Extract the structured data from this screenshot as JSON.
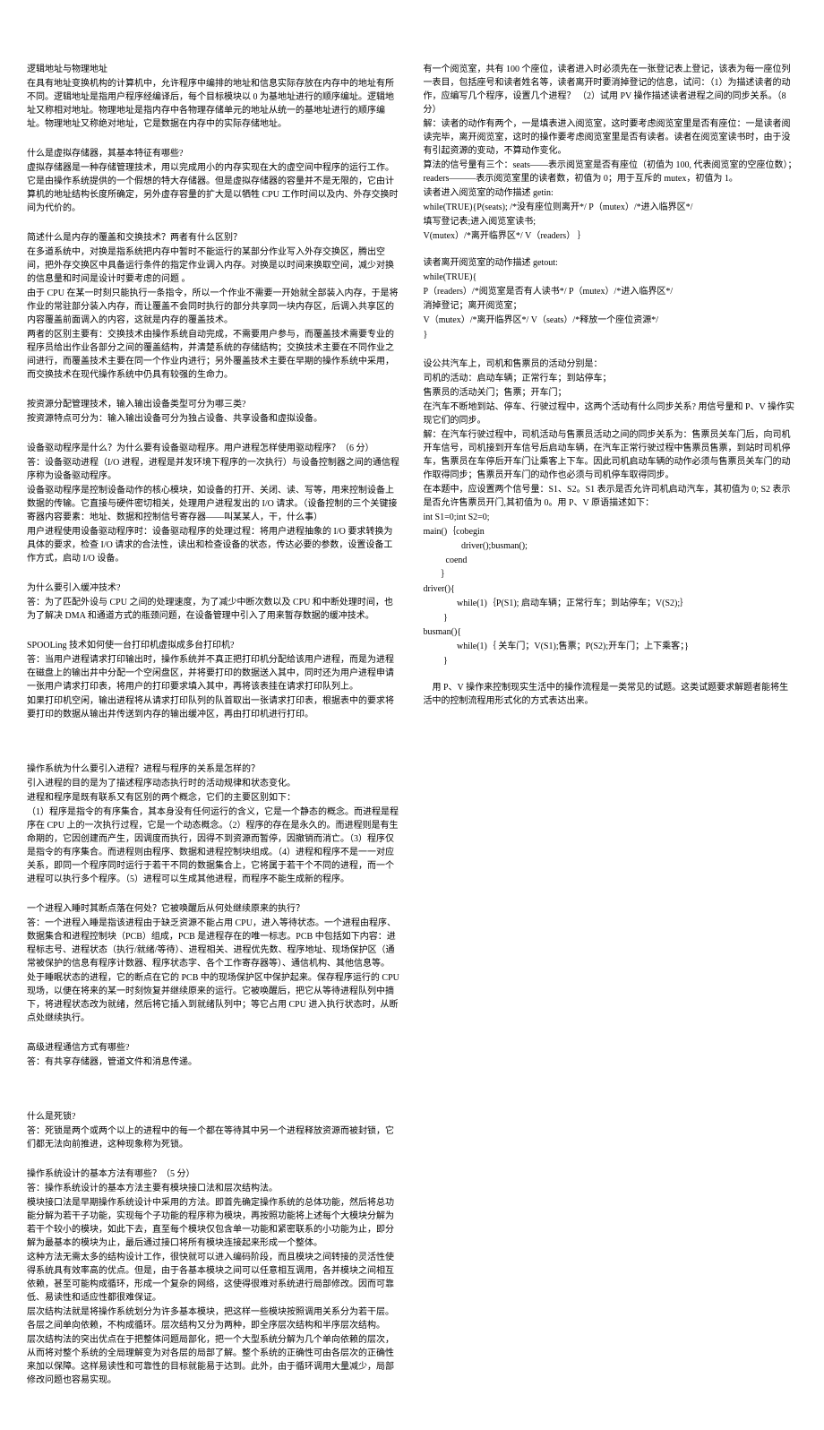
{
  "left": {
    "s1": {
      "title": "逻辑地址与物理地址",
      "p1": "在具有地址变换机构的计算机中，允许程序中编排的地址和信息实际存放在内存中的地址有所不同。逻辑地址是指用户程序经编译后，每个目标模块以 0 为基地址进行的顺序编址。逻辑地址又称相对地址。物理地址是指内存中各物理存储单元的地址从统一的基地址进行的顺序编址。物理地址又称绝对地址，它是数据在内存中的实际存储地址。"
    },
    "s2": {
      "title": "什么是虚拟存储器，其基本特征有哪些?",
      "p1": "虚拟存储器是一种存储管理技术，用以完成用小的内存实现在大的虚空间中程序的运行工作。它是由操作系统提供的一个假想的特大存储器。但是虚拟存储器的容量并不是无限的，它由计算机的地址结构长度所确定，另外虚存容量的扩大是以牺牲 CPU 工作时间以及内、外存交换时间为代价的。"
    },
    "s3": {
      "title": "简述什么是内存的覆盖和交换技术？两者有什么区别？",
      "p1": "在多道系统中，对换是指系统把内存中暂时不能运行的某部分作业写入外存交换区，腾出空间，把外存交换区中具备运行条件的指定作业调入内存。对换是以时间来换取空间，减少对换的信息量和时间是设计时要考虑的问题 。",
      "p2": "由于 CPU 在某一时刻只能执行一条指令，所以一个作业不需要一开始就全部装入内存，于是将作业的常驻部分装入内存，而让覆盖不会同时执行的部分共享同一块内存区，后调入共享区的内容覆盖前面调入的内容，这就是内存的覆盖技术。",
      "p3": "两者的区别主要有：交换技术由操作系统自动完成，不需要用户参与，而覆盖技术需要专业的程序员给出作业各部分之间的覆盖结构，并清楚系统的存储结构；交换技术主要在不同作业之间进行，而覆盖技术主要在同一个作业内进行；另外覆盖技术主要在早期的操作系统中采用，而交换技术在现代操作系统中仍具有较强的生命力。"
    },
    "s4": {
      "title": "按资源分配管理技术，输入输出设备类型可分为哪三类?",
      "p1": "按资源特点可分为：输入输出设备可分为独占设备、共享设备和虚拟设备。"
    },
    "s5": {
      "title": "设备驱动程序是什么？为什么要有设备驱动程序。用户进程怎样使用驱动程序？（6 分）",
      "p1": "答：设备驱动进程（I/O 进程，进程是并发环境下程序的一次执行）与设备控制器之间的通信程序称为设备驱动程序。",
      "p2": "设备驱动程序是控制设备动作的核心模块，如设备的打开、关闭、读、写等，用来控制设备上数据的传输。它直接与硬件密切相关，处理用户进程发出的 I/O 请求。（设备控制的三个关键接寄器内容要素：地址、数据和控制信号寄存器——叫某某人，干，什么事）",
      "p3": "用户进程使用设备驱动程序时：设备驱动程序的处理过程：将用户进程抽象的 I/O 要求转换为具体的要求，检查 I/O 请求的合法性，读出和检查设备的状态，传达必要的参数，设置设备工作方式，启动 I/O 设备。"
    },
    "s6": {
      "title": "为什么要引入缓冲技术?",
      "p1": "答：为了匹配外设与 CPU 之间的处理速度，为了减少中断次数以及 CPU 和中断处理时间，也为了解决 DMA 和通道方式的瓶颈问题，在设备管理中引入了用来暂存数据的缓冲技术。"
    },
    "s7": {
      "title": "SPOOLing 技术如何使一台打印机虚拟成多台打印机?",
      "p1": "答：当用户进程请求打印输出时，操作系统并不真正把打印机分配给该用户进程，而是为进程在磁盘上的输出井中分配一个空闲盘区，并将要打印的数据送入其中，同时还为用户进程申请一张用户请求打印表，将用户的打印要求填入其中，再将该表挂在请求打印队列上。",
      "p2": "如果打印机空闲，输出进程将从请求打印队列的队首取出一张请求打印表，根据表中的要求将要打印的数据从输出井传送到内存的输出缓冲区，再由打印机进行打印。"
    },
    "s8": {
      "title": "操作系统为什么要引入进程？进程与程序的关系是怎样的？",
      "p1": "引入进程的目的是为了描述程序动态执行时的活动规律和状态变化。",
      "p2": "进程和程序是既有联系又有区别的两个概念，它们的主要区别如下：",
      "p3": "（1）程序是指令的有序集合，其本身没有任何运行的含义，它是一个静态的概念。而进程是程序在 CPU 上的一次执行过程，它是一个动态概念。（2）程序的存在是永久的。而进程则是有生命期的，它因创建而产生，因调度而执行，因得不到资源而暂停，因撤销而消亡。（3）程序仅是指令的有序集合。而进程则由程序、数据和进程控制块组成。（4）进程和程序不是一一对应关系，即同一个程序同时运行于若干不同的数据集合上，它将属于若干个不同的进程，而一个进程可以执行多个程序。（5）进程可以生成其他进程，而程序不能生成新的程序。"
    },
    "s9": {
      "title": "一个进程入睡时其断点落在何处？它被唤醒后从何处继续原来的执行？",
      "p1": "答：一个进程入睡是指该进程由于缺乏资源不能占用 CPU，进入等待状态。一个进程由程序、数据集合和进程控制块（PCB）组成，PCB 是进程存在的唯一标志。PCB 中包括如下内容：进程标志号、进程状态（执行/就绪/等待）、进程相关、进程优先数、程序地址、现场保护区（通常被保护的信息有程序计数器、程序状态字、各个工作寄存器等）、通信机构、其他信息等。",
      "p2": "处于睡眠状态的进程，它的断点在它的 PCB 中的现场保护区中保护起来。保存程序运行的 CPU 现场，以便在将来的某一时刻恢复并继续原来的运行。它被唤醒后，把它从等待进程队列中摘下，将进程状态改为就绪，然后将它插入到就绪队列中；等它占用 CPU 进入执行状态时，从断点处继续执行。"
    },
    "s10": {
      "title": "高级进程通信方式有哪些?",
      "p1": "答：有共享存储器，管道文件和消息传递。"
    },
    "s11": {
      "title": "什么是死锁?",
      "p1": "答：死锁是两个或两个以上的进程中的每一个都在等待其中另一个进程释放资源而被封锁，它们都无法向前推进，这种现象称为死锁。"
    },
    "s12": {
      "title": "操作系统设计的基本方法有哪些？（5 分）",
      "p1": "答：操作系统设计的基本方法主要有模块接口法和层次结构法。",
      "p2": "模块接口法是早期操作系统设计中采用的方法。即首先确定操作系统的总体功能，然后将总功能分解为若干子功能，实现每个子功能的程序称为模块，再按照功能将上述每个大模块分解为若干个较小的模块，如此下去，直至每个模块仅包含单一功能和紧密联系的小功能为止，即分解为最基本的模块为止，最后通过接口将所有模块连接起来形成一个整体。",
      "p3": "这种方法无需太多的结构设计工作，很快就可以进入编码阶段，而且模块之间转接的灵活性使得系统具有效率高的优点。但是，由于各基本模块之间可以任意相互调用，各并模块之间相互依赖，甚至可能构成循环，形成一个复杂的网络，这使得很难对系统进行局部修改。因而可靠低、易读性和适应性都很难保证。",
      "p4": "层次结构法就是将操作系统划分为许多基本模块，把这样一些模块按照调用关系分为若干层。各层之间单向依赖，不构成循环。层次结构又分为两种，即全序层次结构和半序层次结构。",
      "p5": "层次结构法的突出优点在于把整体问题局部化，把一个大型系统分解为几个单向依赖的层次，从而将对整个系统的全局理解变为对各层的局部了解。整个系统的正确性可由各层次的正确性来加以保障。这样易读性和可靠性的目标就能易于达到。此外，由于循环调用大量减少，局部修改问题也容易实现。"
    }
  },
  "right": {
    "s1": {
      "p1": "有一个阅览室，共有 100 个座位，读者进入时必须先在一张登记表上登记，该表为每一座位列一表目，包括座号和读者姓名等，读者离开时要消掉登记的信息，试问：（1）为描述读者的动作，应编写几个程序，设置几个进程？  （2）试用 PV 操作描述读者进程之间的同步关系。（8 分）",
      "p2": "解：读者的动作有两个，一是填表进入阅览室，这时要考虑阅览室里是否有座位：一是读者阅读完毕，离开阅览室，这时的操作要考虑阅览室里是否有读者。读者在阅览室读书时，由于没有引起资源的变动，不算动作变化。",
      "p3": "算法的信号量有三个：seats——表示阅览室是否有座位（初值为 100, 代表阅览室的空座位数）；readers———表示阅览室里的读者数，初值为 0；用于互斥的 mutex，初值为 1。",
      "p4": "读者进入阅览室的动作描述 getin:",
      "p5": "while(TRUE){P(seats); /*没有座位则离开*/  P（mutex）/*进入临界区*/",
      "p6": "填写登记表;进入阅览室读书;",
      "p7": "V(mutex）/*离开临界区*/  V（readers） ｝",
      "p8": "读者离开阅览室的动作描述 getout:",
      "p9": "while(TRUE){",
      "p10": "P（readers）/*阅览室是否有人读书*/     P（mutex）/*进入临界区*/",
      "p11": "消掉登记；离开阅览室；",
      "p12": "V（mutex）/*离开临界区*/   V（seats）/*释放一个座位资源*/",
      "p13": "}"
    },
    "s2": {
      "p1": "设公共汽车上，司机和售票员的活动分别是：",
      "p2": "司机的活动：启动车辆；正常行车；到站停车；",
      "p3": "售票员的活动关门；售票；开车门；",
      "p4": "在汽车不断地到站、停车、行驶过程中，这两个活动有什么同步关系? 用信号量和 P、V 操作实现它们的同步。",
      "p5": "解：在汽车行驶过程中，司机活动与售票员活动之间的同步关系为：售票员关车门后，向司机开车信号，司机接到开车信号后启动车辆，在汽车正常行驶过程中售票员售票，到站时司机停车，售票员在车停后开车门让乘客上下车。因此司机启动车辆的动作必须与售票员关车门的动作取得同步；售票员开车门的动作也必须与司机停车取得同步。",
      "p6": "在本题中，应设置两个信号量：S1、S2。S1 表示是否允许司机启动汽车，其初值为 0; S2 表示是否允许售票员开门,其初值为 0。用 P、V 原语描述如下：",
      "p7": "int S1=0;int S2=0;",
      "p8": "main()｛cobegin",
      "p9": "                 driver();busman();",
      "p10": "          coend",
      "p11": "        ｝",
      "p12": "driver(){",
      "p13": "               while(1)｛P(S1); 启动车辆；正常行车；到站停车；V(S2);｝",
      "p14": "         }",
      "p15": "busman(){",
      "p16": "               while(1)｛ 关车门；V(S1);售票；P(S2);开车门；上下乘客；}",
      "p17": "         }",
      "p18": "　用 P、V 操作来控制现实生活中的操作流程是一类常见的试题。这类试题要求解题者能将生活中的控制流程用形式化的方式表达出来。"
    }
  }
}
